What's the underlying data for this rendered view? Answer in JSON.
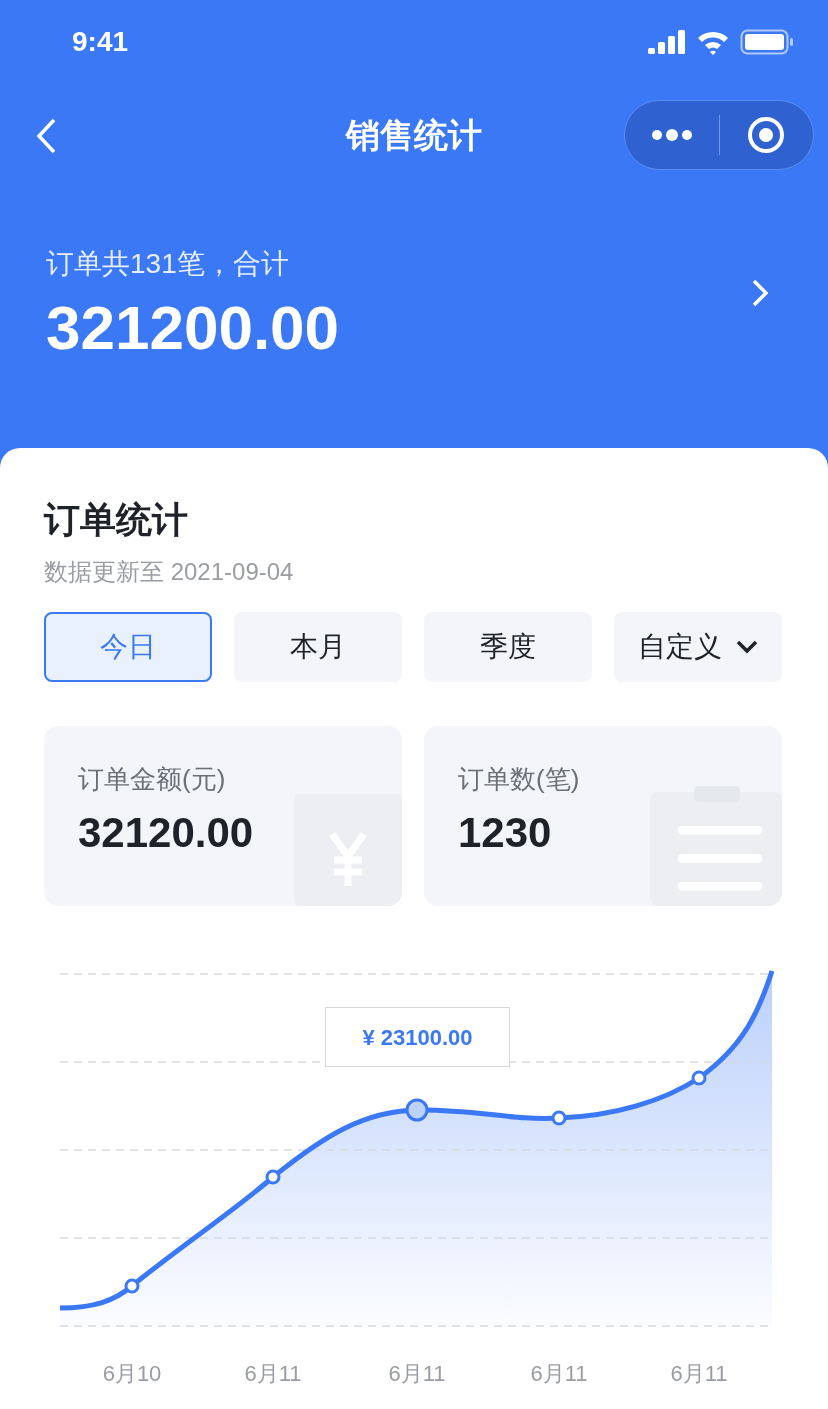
{
  "status_bar": {
    "time": "9:41"
  },
  "nav": {
    "title": "销售统计"
  },
  "summary": {
    "caption": "订单共131笔，合计",
    "total": "321200.00"
  },
  "card": {
    "title": "订单统计",
    "subtitle": "数据更新至 2021-09-04",
    "tabs": [
      {
        "label": "今日",
        "selected": true,
        "kind": "plain"
      },
      {
        "label": "本月",
        "selected": false,
        "kind": "plain"
      },
      {
        "label": "季度",
        "selected": false,
        "kind": "plain"
      },
      {
        "label": "自定义",
        "selected": false,
        "kind": "dropdown"
      }
    ],
    "stats": [
      {
        "label": "订单金额(元)",
        "value": "32120.00",
        "kind": "money"
      },
      {
        "label": "订单数(笔)",
        "value": "1230",
        "kind": "count"
      }
    ],
    "chart": {
      "tooltip": "¥ 23100.00",
      "x_labels": [
        "6月10",
        "6月11",
        "6月11",
        "6月11",
        "6月11"
      ]
    }
  }
}
